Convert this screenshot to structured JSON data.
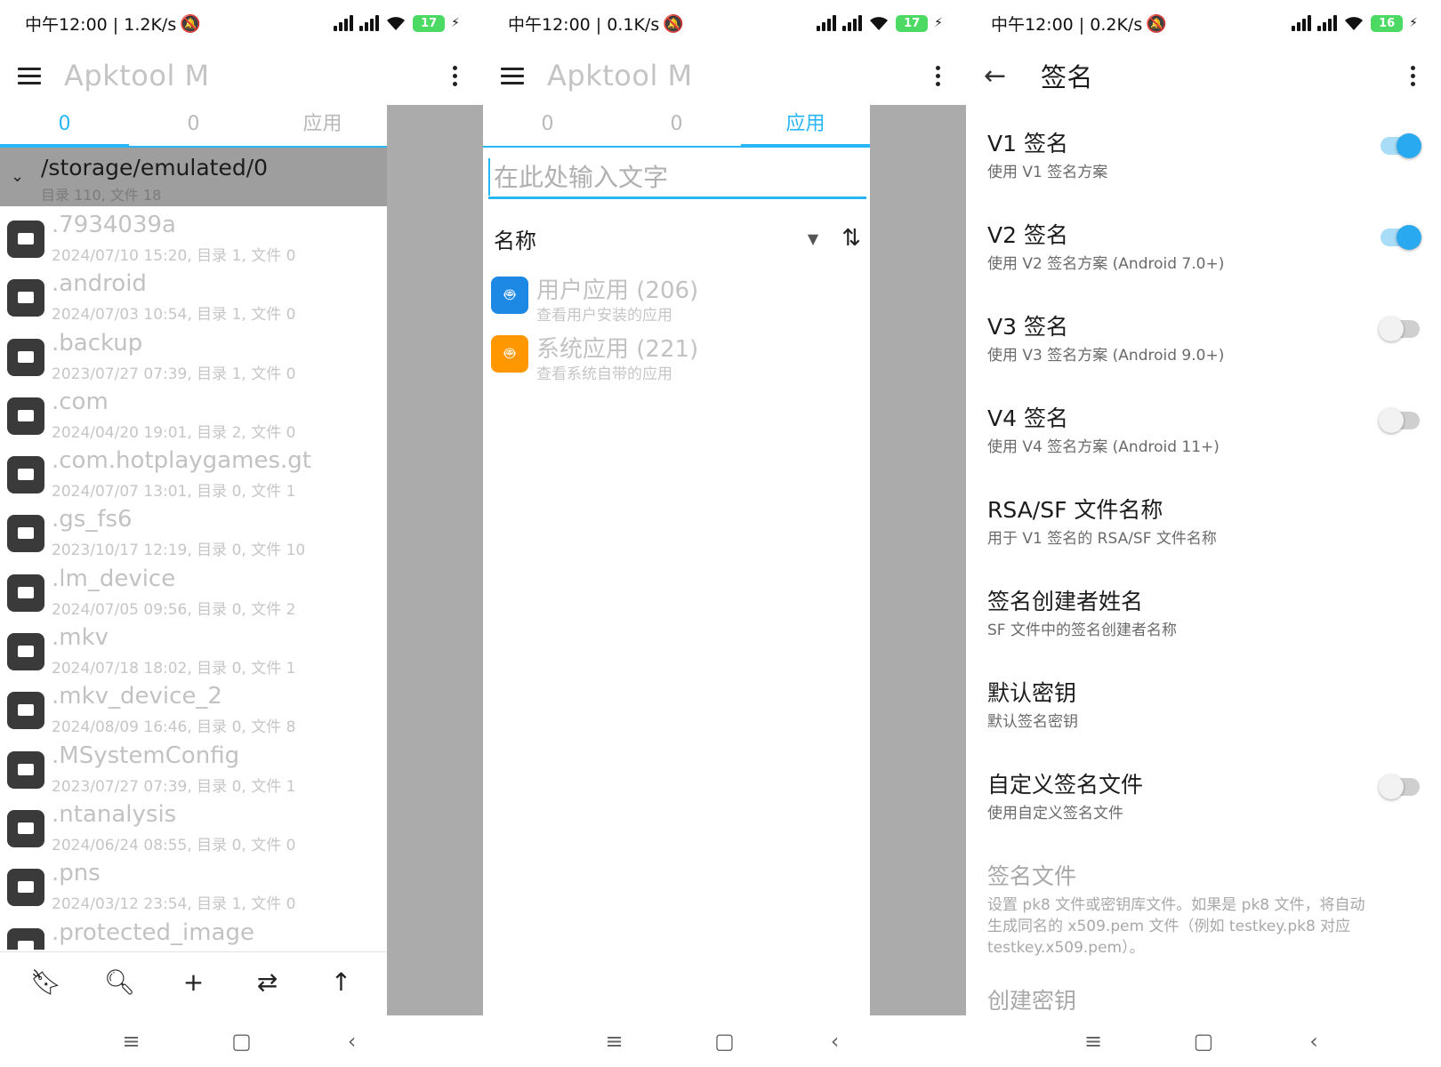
{
  "screens": [
    {
      "status": {
        "time": "中午12:00 | 1.2K/s",
        "battery": "17"
      },
      "appbar": {
        "title": "Apktool M"
      },
      "tabs": [
        {
          "label": "0",
          "active": true
        },
        {
          "label": "0",
          "active": false
        },
        {
          "label": "应用",
          "active": false
        }
      ],
      "path": {
        "title": "/storage/emulated/0",
        "summary": "目录 110, 文件 18"
      },
      "files": [
        {
          "name": ".7934039a",
          "meta": "2024/07/10 15:20, 目录 1, 文件 0"
        },
        {
          "name": ".android",
          "meta": "2024/07/03 10:54, 目录 1, 文件 0"
        },
        {
          "name": ".backup",
          "meta": "2023/07/27 07:39, 目录 1, 文件 0"
        },
        {
          "name": ".com",
          "meta": "2024/04/20 19:01, 目录 2, 文件 0"
        },
        {
          "name": ".com.hotplaygames.gt",
          "meta": "2024/07/07 13:01, 目录 0, 文件 1"
        },
        {
          "name": ".gs_fs6",
          "meta": "2023/10/17 12:19, 目录 0, 文件 10"
        },
        {
          "name": ".lm_device",
          "meta": "2024/07/05 09:56, 目录 0, 文件 2"
        },
        {
          "name": ".mkv",
          "meta": "2024/07/18 18:02, 目录 0, 文件 1"
        },
        {
          "name": ".mkv_device_2",
          "meta": "2024/08/09 16:46, 目录 0, 文件 8"
        },
        {
          "name": ".MSystemConfig",
          "meta": "2023/07/27 07:39, 目录 0, 文件 1"
        },
        {
          "name": ".ntanalysis",
          "meta": "2024/06/24 08:55, 目录 0, 文件 0"
        },
        {
          "name": ".pns",
          "meta": "2024/03/12 23:54, 目录 1, 文件 0"
        },
        {
          "name": ".protected_image",
          "meta": ""
        }
      ]
    },
    {
      "status": {
        "time": "中午12:00 | 0.1K/s",
        "battery": "17"
      },
      "appbar": {
        "title": "Apktool M"
      },
      "tabs": [
        {
          "label": "0",
          "active": false
        },
        {
          "label": "0",
          "active": false
        },
        {
          "label": "应用",
          "active": true
        }
      ],
      "search": {
        "placeholder": "在此处输入文字"
      },
      "sort": {
        "label": "名称"
      },
      "apps": [
        {
          "name": "用户应用 (206)",
          "summary": "查看用户安装的应用",
          "color": "#1e88e5"
        },
        {
          "name": "系统应用 (221)",
          "summary": "查看系统自带的应用",
          "color": "#ff9800"
        }
      ]
    },
    {
      "status": {
        "time": "中午12:00 | 0.2K/s",
        "battery": "16"
      },
      "appbar": {
        "title": "签名"
      },
      "prefs": [
        {
          "title": "V1 签名",
          "summary": "使用 V1 签名方案",
          "switch": "on"
        },
        {
          "title": "V2 签名",
          "summary": "使用 V2 签名方案 (Android 7.0+)",
          "switch": "on"
        },
        {
          "title": "V3 签名",
          "summary": "使用 V3 签名方案 (Android 9.0+)",
          "switch": "off"
        },
        {
          "title": "V4 签名",
          "summary": "使用 V4 签名方案 (Android 11+)",
          "switch": "off"
        },
        {
          "title": "RSA/SF 文件名称",
          "summary": "用于 V1 签名的 RSA/SF 文件名称",
          "switch": "none"
        },
        {
          "title": "签名创建者姓名",
          "summary": "SF 文件中的签名创建者名称",
          "switch": "none"
        },
        {
          "title": "默认密钥",
          "summary": "默认签名密钥",
          "switch": "none"
        },
        {
          "title": "自定义签名文件",
          "summary": "使用自定义签名文件",
          "switch": "off"
        },
        {
          "title": "签名文件",
          "summary": "设置 pk8 文件或密钥库文件。如果是 pk8 文件，将自动生成同名的 x509.pem 文件（例如 testkey.pk8 对应 testkey.x509.pem）。",
          "switch": "none",
          "disabled": true
        },
        {
          "title": "创建密钥",
          "summary": "",
          "switch": "none",
          "disabled": true
        }
      ]
    }
  ],
  "colors": {
    "accent": "#29b6f6",
    "switch_on": "#29a9f0"
  }
}
